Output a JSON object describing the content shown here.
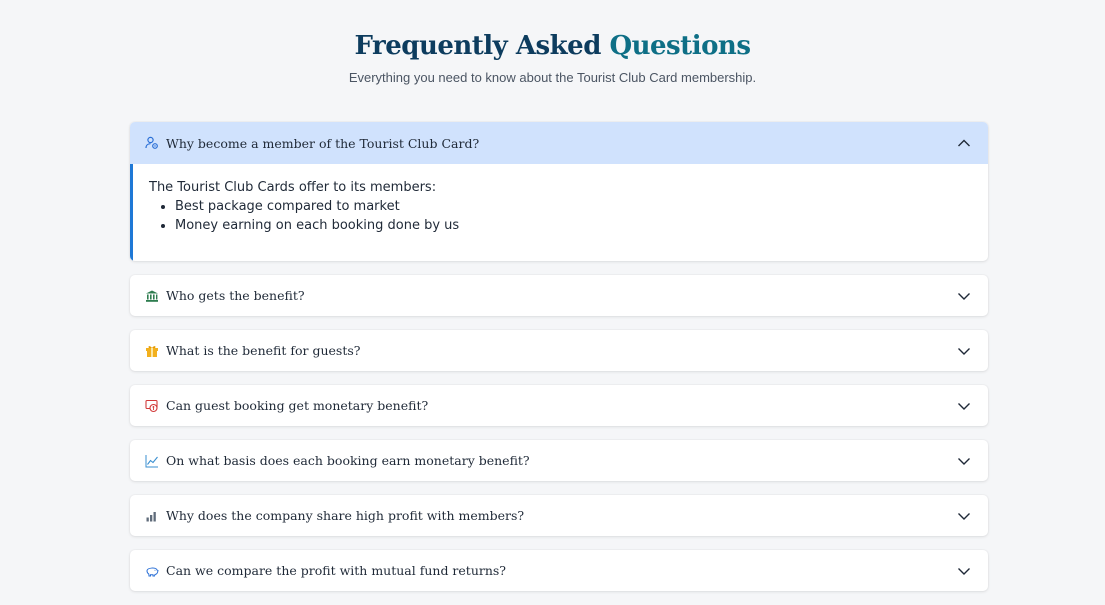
{
  "header": {
    "title_main": "Frequently Asked",
    "title_accent": "Questions",
    "subtitle": "Everything you need to know about the Tourist Club Card membership."
  },
  "colors": {
    "title": "#0d3c5e",
    "accent": "#0e6f86",
    "open_header_bg": "#d0e2fd",
    "open_border": "#1e78d6"
  },
  "faq": [
    {
      "icon": "user-gear-icon",
      "question": "Why become a member of the Tourist Club Card?",
      "expanded": true,
      "answer_intro": "The Tourist Club Cards offer to its members:",
      "answer_points": [
        "Best package compared to market",
        "Money earning on each booking done by us"
      ]
    },
    {
      "icon": "bank-icon",
      "question": "Who gets the benefit?",
      "expanded": false
    },
    {
      "icon": "gift-icon",
      "question": "What is the benefit for guests?",
      "expanded": false
    },
    {
      "icon": "money-tag-icon",
      "question": "Can guest booking get monetary benefit?",
      "expanded": false
    },
    {
      "icon": "line-chart-icon",
      "question": "On what basis does each booking earn monetary benefit?",
      "expanded": false
    },
    {
      "icon": "bar-chart-icon",
      "question": "Why does the company share high profit with members?",
      "expanded": false
    },
    {
      "icon": "piggy-bank-icon",
      "question": "Can we compare the profit with mutual fund returns?",
      "expanded": false
    }
  ]
}
